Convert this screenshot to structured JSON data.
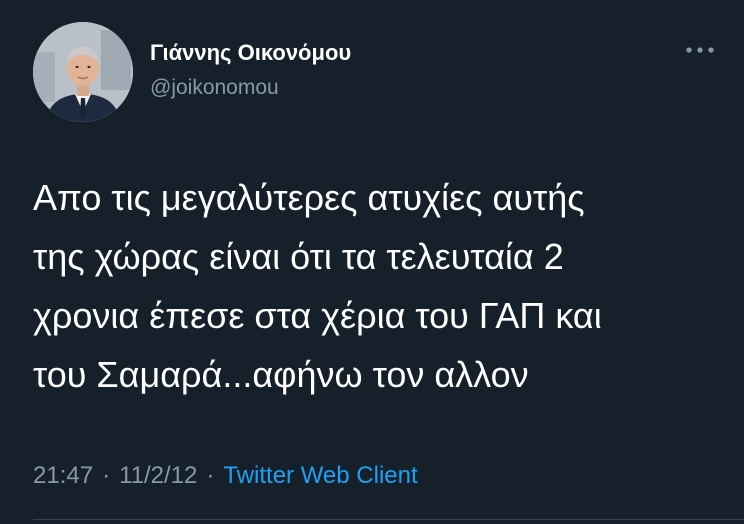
{
  "author": {
    "display_name": "Γιάννης Οικονόμου",
    "username": "@joikonomou",
    "avatar_icon": "profile-photo"
  },
  "more_icon": "more-horizontal-icon",
  "tweet": {
    "lines": [
      "Απο τις μεγαλύτερες ατυχίες αυτής",
      "της χώρας είναι ότι τα τελευταία 2",
      "χρονια έπεσε στα χέρια του ΓΑΠ και",
      "του Σαμαρά...αφήνω τον αλλον"
    ]
  },
  "meta": {
    "time": "21:47",
    "separator": "·",
    "date": "11/2/12",
    "client": "Twitter Web Client"
  },
  "colors": {
    "background": "#15202b",
    "secondary_text": "#8899a6",
    "link": "#1da1f2",
    "divider": "#38444d"
  }
}
